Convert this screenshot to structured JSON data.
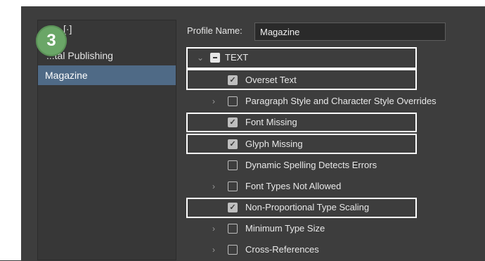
{
  "badge": {
    "step": "3"
  },
  "profiles": {
    "items": [
      {
        "label": "[Basic]",
        "selected": false
      },
      {
        "label": "Digital Publishing",
        "selected": false
      },
      {
        "label": "Magazine",
        "selected": true
      }
    ],
    "visible_fragments": [
      "[·]",
      "...tal Publishing",
      "Magazine"
    ]
  },
  "profile_name": {
    "label": "Profile Name:",
    "value": "Magazine"
  },
  "tree": {
    "section": {
      "label": "TEXT",
      "state": "mixed",
      "expanded": true
    },
    "rows": [
      {
        "label": "Overset Text",
        "checked": true,
        "expandable": false
      },
      {
        "label": "Paragraph Style and Character Style Overrides",
        "checked": false,
        "expandable": true
      },
      {
        "label": "Font Missing",
        "checked": true,
        "expandable": false
      },
      {
        "label": "Glyph Missing",
        "checked": true,
        "expandable": false
      },
      {
        "label": "Dynamic Spelling Detects Errors",
        "checked": false,
        "expandable": false
      },
      {
        "label": "Font Types Not Allowed",
        "checked": false,
        "expandable": true
      },
      {
        "label": "Non-Proportional Type Scaling",
        "checked": true,
        "expandable": false
      },
      {
        "label": "Minimum Type Size",
        "checked": false,
        "expandable": true
      },
      {
        "label": "Cross-References",
        "checked": false,
        "expandable": true
      }
    ]
  },
  "icons": {
    "expand_open": "chevron-down-icon",
    "expand_closed": "chevron-right-icon",
    "check": "checkmark-icon"
  },
  "colors": {
    "background": "#3b3b3b",
    "selection": "#4f6a86",
    "badge": "#6aa667",
    "highlight": "#ffffff"
  }
}
